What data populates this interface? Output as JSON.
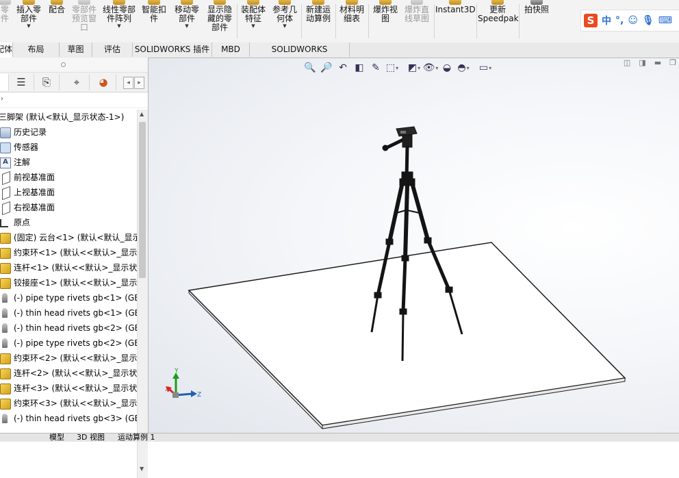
{
  "ribbon": {
    "buttons": [
      {
        "label": "零\n件",
        "disabled": true
      },
      {
        "label": "插入零\n部件",
        "disabled": false
      },
      {
        "label": "配合",
        "disabled": false
      },
      {
        "label": "零部件\n预览窗\n口",
        "disabled": true
      },
      {
        "label": "线性零部\n件阵列",
        "disabled": false
      },
      {
        "label": "智能扣\n件",
        "disabled": false
      },
      {
        "label": "移动零\n部件",
        "disabled": false
      },
      {
        "label": "显示隐\n藏的零\n部件",
        "disabled": false
      },
      {
        "label": "装配体\n特征",
        "disabled": false
      },
      {
        "label": "参考几\n何体",
        "disabled": false
      },
      {
        "label": "新建运\n动算例",
        "disabled": false
      },
      {
        "label": "材料明\n细表",
        "disabled": false
      },
      {
        "label": "爆炸视\n图",
        "disabled": false
      },
      {
        "label": "爆炸直\n线草图",
        "disabled": true
      },
      {
        "label": "Instant3D",
        "disabled": false
      },
      {
        "label": "更新\nSpeedpak",
        "disabled": false
      },
      {
        "label": "拍快照",
        "disabled": false
      }
    ],
    "ime": {
      "logo": "S",
      "mode": "中",
      "punct": "°,"
    }
  },
  "tabs": [
    "装配体",
    "布局",
    "草图",
    "评估",
    "SOLIDWORKS 插件",
    "MBD",
    "SOLIDWORKS Inspection"
  ],
  "tree": {
    "root": "三脚架 (默认<默认_显示状态-1>)",
    "items": [
      {
        "label": "历史记录",
        "icon": "history-folder-icon"
      },
      {
        "label": "传感器",
        "icon": "sensor-folder-icon"
      },
      {
        "label": "注解",
        "icon": "annotation-icon"
      },
      {
        "label": "前视基准面",
        "icon": "plane-icon"
      },
      {
        "label": "上视基准面",
        "icon": "plane-icon"
      },
      {
        "label": "右视基准面",
        "icon": "plane-icon"
      },
      {
        "label": "原点",
        "icon": "origin-icon"
      },
      {
        "label": "(固定) 云台<1> (默认<默认_显示",
        "icon": "part-icon"
      },
      {
        "label": "约束环<1> (默认<<默认>_显示状",
        "icon": "part-icon"
      },
      {
        "label": "连杆<1> (默认<<默认>_显示状态",
        "icon": "part-icon"
      },
      {
        "label": "铰接座<1> (默认<<默认>_显示状",
        "icon": "part-icon"
      },
      {
        "label": "(-) pipe type rivets gb<1> (GB",
        "icon": "rivet-icon"
      },
      {
        "label": "(-) thin head rivets gb<1> (GB",
        "icon": "rivet-icon"
      },
      {
        "label": "(-) thin head rivets gb<2> (GB",
        "icon": "rivet-icon"
      },
      {
        "label": "(-) pipe type rivets gb<2> (GB",
        "icon": "rivet-icon"
      },
      {
        "label": "约束环<2> (默认<<默认>_显示状",
        "icon": "part-icon"
      },
      {
        "label": "连杆<2> (默认<<默认>_显示状态",
        "icon": "part-icon"
      },
      {
        "label": "连杆<3> (默认<<默认>_显示状态",
        "icon": "part-icon"
      },
      {
        "label": "约束环<3> (默认<<默认>_显示状",
        "icon": "part-icon"
      },
      {
        "label": "(-) thin head rivets gb<3> (GB",
        "icon": "rivet-icon"
      }
    ]
  },
  "bottom_tabs": [
    "模型",
    "3D 视图",
    "运动算例 1"
  ],
  "triad": {
    "x": "X",
    "y": "Y",
    "z": "Z"
  },
  "colors": {
    "accent": "#1f5fb5",
    "ime_logo": "#e84c1f"
  }
}
